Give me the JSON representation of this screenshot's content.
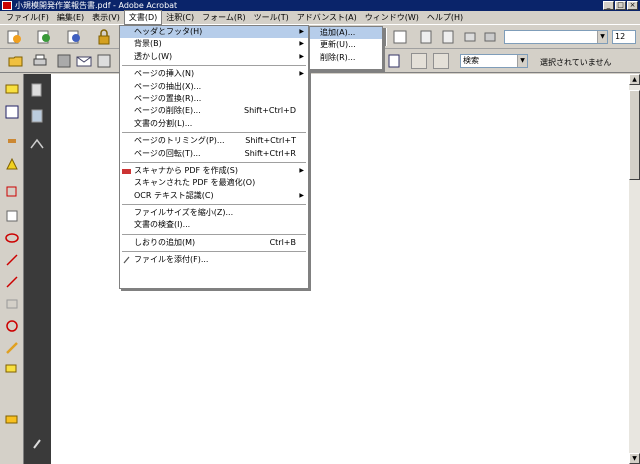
{
  "window": {
    "title": "小規模開発作業報告書.pdf - Adobe Acrobat"
  },
  "menubar": [
    {
      "label": "ファイル(F)"
    },
    {
      "label": "編集(E)"
    },
    {
      "label": "表示(V)"
    },
    {
      "label": "文書(D)"
    },
    {
      "label": "注釈(C)"
    },
    {
      "label": "フォーム(R)"
    },
    {
      "label": "ツール(T)"
    },
    {
      "label": "アドバンスト(A)"
    },
    {
      "label": "ウィンドウ(W)"
    },
    {
      "label": "ヘルプ(H)"
    }
  ],
  "toolbar": {
    "search_value": "検索",
    "selection_status": "選択されていません",
    "font_size_value": "12"
  },
  "document_menu": {
    "items": [
      {
        "label": "ヘッダとフッタ(H)",
        "shortcut": "",
        "submenu": true
      },
      {
        "label": "背景(B)",
        "shortcut": "",
        "submenu": true
      },
      {
        "label": "透かし(W)",
        "shortcut": "",
        "submenu": true
      },
      {
        "label": "ページの挿入(N)",
        "shortcut": "",
        "submenu": true
      },
      {
        "label": "ページの抽出(X)...",
        "shortcut": ""
      },
      {
        "label": "ページの置換(R)...",
        "shortcut": ""
      },
      {
        "label": "ページの削除(E)...",
        "shortcut": "Shift+Ctrl+D"
      },
      {
        "label": "文書の分割(L)...",
        "shortcut": ""
      },
      {
        "label": "ページのトリミング(P)...",
        "shortcut": "Shift+Ctrl+T"
      },
      {
        "label": "ページの回転(T)...",
        "shortcut": "Shift+Ctrl+R"
      },
      {
        "label": "スキャナから PDF を作成(S)",
        "shortcut": "",
        "submenu": true
      },
      {
        "label": "スキャンされた PDF を最適化(O)",
        "shortcut": ""
      },
      {
        "label": "OCR テキスト認識(C)",
        "shortcut": "",
        "submenu": true
      },
      {
        "label": "ファイルサイズを縮小(Z)...",
        "shortcut": ""
      },
      {
        "label": "文書の検査(I)...",
        "shortcut": ""
      },
      {
        "label": "しおりの追加(M)",
        "shortcut": "Ctrl+B"
      },
      {
        "label": "ファイルを添付(F)...",
        "shortcut": ""
      }
    ]
  },
  "header_footer_submenu": {
    "items": [
      {
        "label": "追加(A)..."
      },
      {
        "label": "更新(U)..."
      },
      {
        "label": "削除(R)..."
      }
    ]
  },
  "icons": {
    "submenu_arrow": "▶",
    "dropdown_arrow": "▼",
    "scroll_up": "▲",
    "scroll_down": "▼",
    "minimize": "_",
    "maximize": "□",
    "close": "×"
  },
  "colors": {
    "titlebar": "#0a246a",
    "menu_highlight": "#b6cdea",
    "chrome": "#d4d0c8",
    "nav_panel": "#3a3a3a"
  }
}
